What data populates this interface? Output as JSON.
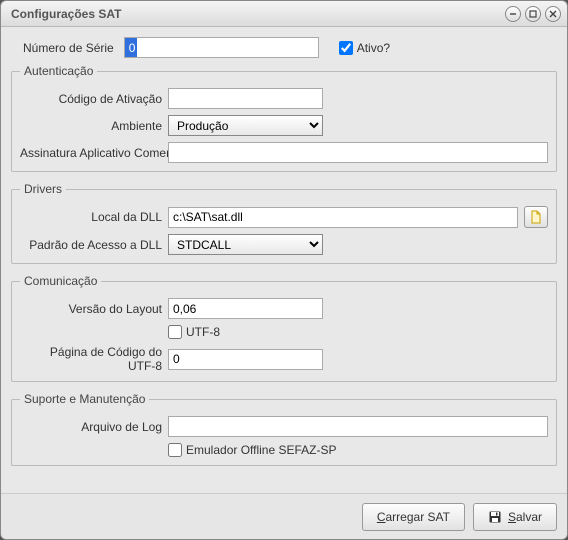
{
  "window": {
    "title": "Configurações SAT"
  },
  "top": {
    "serial_label": "Número de Série",
    "serial_value": "0",
    "active_label": "Ativo?",
    "active_checked": true
  },
  "auth": {
    "legend": "Autenticação",
    "activation_code_label": "Código de Ativação",
    "activation_code_value": "",
    "ambiente_label": "Ambiente",
    "ambiente_value": "Produção",
    "assinatura_label": "Assinatura Aplicativo Comercial",
    "assinatura_value": ""
  },
  "drivers": {
    "legend": "Drivers",
    "dll_local_label": "Local da DLL",
    "dll_local_value": "c:\\SAT\\sat.dll",
    "padrao_label": "Padrão de Acesso a DLL",
    "padrao_value": "STDCALL",
    "browse_icon": "file-icon"
  },
  "comunicacao": {
    "legend": "Comunicação",
    "versao_label": "Versão do Layout",
    "versao_value": "0,06",
    "utf8_label": "UTF-8",
    "utf8_checked": false,
    "pagina_label": "Página de Código do UTF-8",
    "pagina_value": "0"
  },
  "suporte": {
    "legend": "Suporte e Manutenção",
    "log_label": "Arquivo de Log",
    "log_value": "",
    "emulador_label": "Emulador Offline SEFAZ-SP",
    "emulador_checked": false
  },
  "footer": {
    "load_label": "Carregar SAT",
    "save_label": "Salvar"
  }
}
